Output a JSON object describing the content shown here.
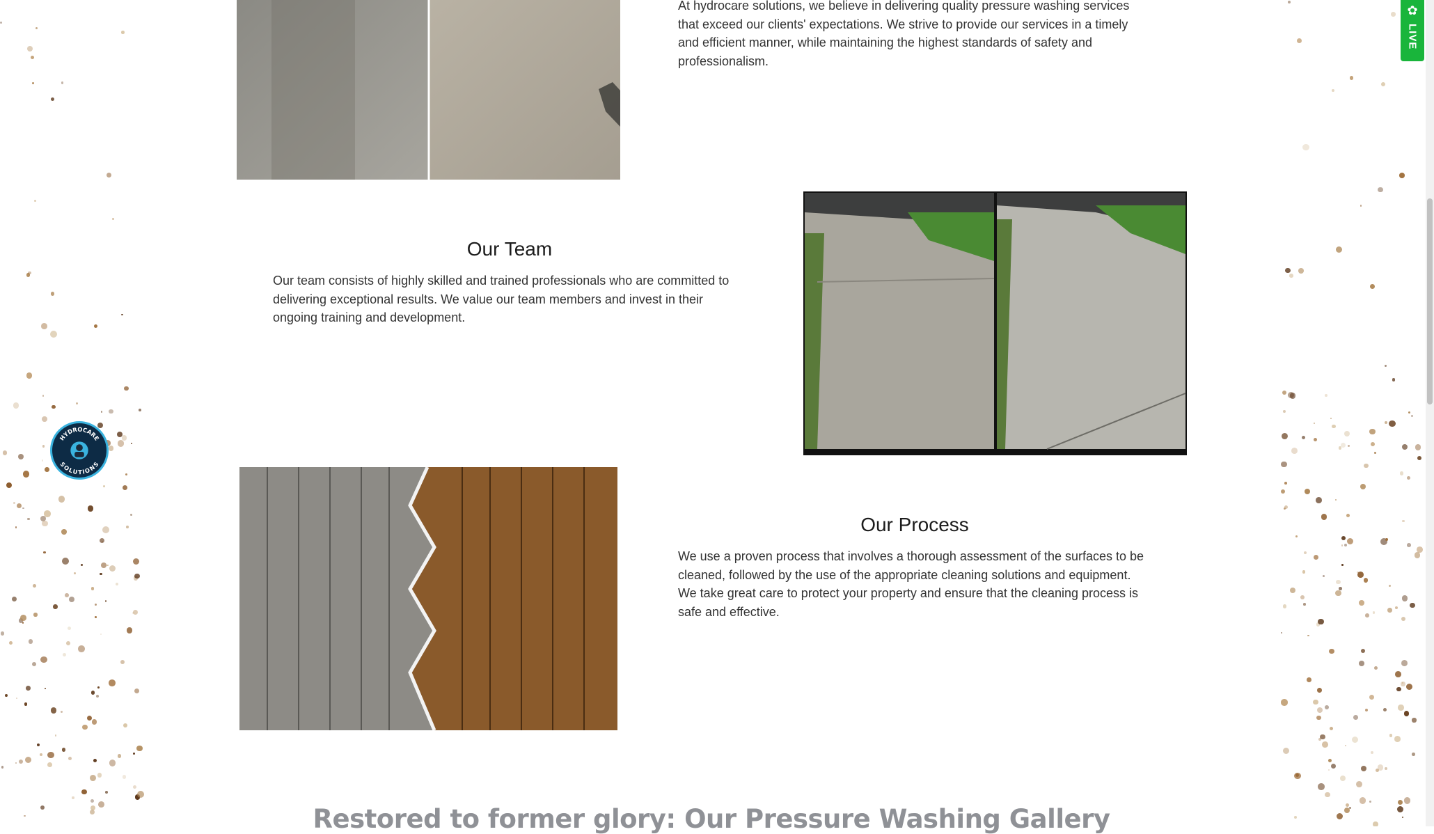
{
  "intro": {
    "paragraph": "At hydrocare solutions, we believe in delivering quality pressure washing services that exceed our clients' expectations. We strive to provide our services in a timely and efficient manner, while maintaining the highest standards of safety and professionalism."
  },
  "team": {
    "heading": "Our Team",
    "paragraph": "Our team consists of highly skilled and trained professionals who are committed to delivering exceptional results. We value our team members and invest in their ongoing training and development."
  },
  "process": {
    "heading": "Our Process",
    "paragraph": "We use a proven process that involves a thorough assessment of the surfaces to be cleaned, followed by the use of the appropriate cleaning solutions and equipment. We take great care to protect your property and ensure that the cleaning process is safe and effective."
  },
  "gallery": {
    "heading": "Restored to former glory: Our Pressure Washing Gallery"
  },
  "live_tab": {
    "label": "LIVE",
    "icon": "gear-icon"
  },
  "badge": {
    "text_top": "HYDROCARE",
    "text_bottom": "SOLUTIONS"
  },
  "colors": {
    "live_green": "#19b53b",
    "heading": "#1c1c1c",
    "gallery_heading": "#8f9196",
    "badge_ring": "#3ab3df"
  }
}
